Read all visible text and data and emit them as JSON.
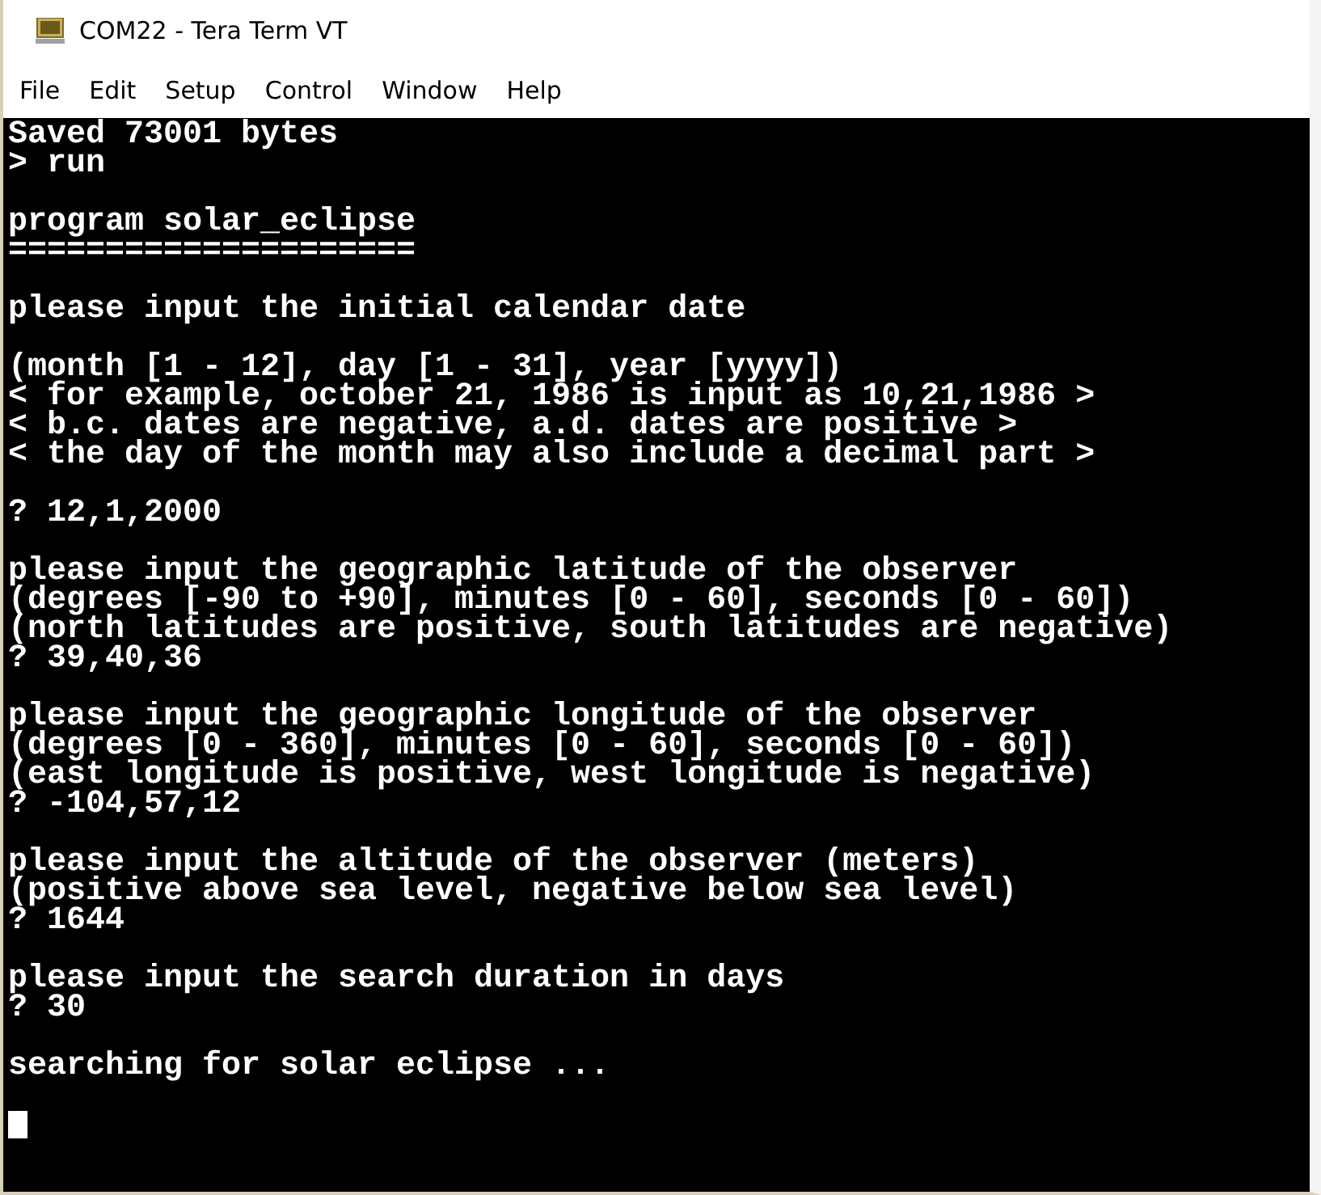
{
  "window": {
    "title": "COM22 - Tera Term VT"
  },
  "menu": [
    "File",
    "Edit",
    "Setup",
    "Control",
    "Window",
    "Help"
  ],
  "terminal": {
    "blocks": [
      [
        "Saved 73001 bytes",
        "> run"
      ],
      [
        "program solar_eclipse",
        "====================="
      ],
      [
        "please input the initial calendar date"
      ],
      [
        "(month [1 - 12], day [1 - 31], year [yyyy])",
        "< for example, october 21, 1986 is input as 10,21,1986 >",
        "< b.c. dates are negative, a.d. dates are positive >",
        "< the day of the month may also include a decimal part >"
      ],
      [
        "? 12,1,2000"
      ],
      [
        "please input the geographic latitude of the observer",
        "(degrees [-90 to +90], minutes [0 - 60], seconds [0 - 60])",
        "(north latitudes are positive, south latitudes are negative)",
        "? 39,40,36"
      ],
      [
        "please input the geographic longitude of the observer",
        "(degrees [0 - 360], minutes [0 - 60], seconds [0 - 60])",
        "(east longitude is positive, west longitude is negative)",
        "? -104,57,12"
      ],
      [
        "please input the altitude of the observer (meters)",
        "(positive above sea level, negative below sea level)",
        "? 1644"
      ],
      [
        "please input the search duration in days",
        "? 30"
      ],
      [
        "searching for solar eclipse ..."
      ]
    ]
  }
}
